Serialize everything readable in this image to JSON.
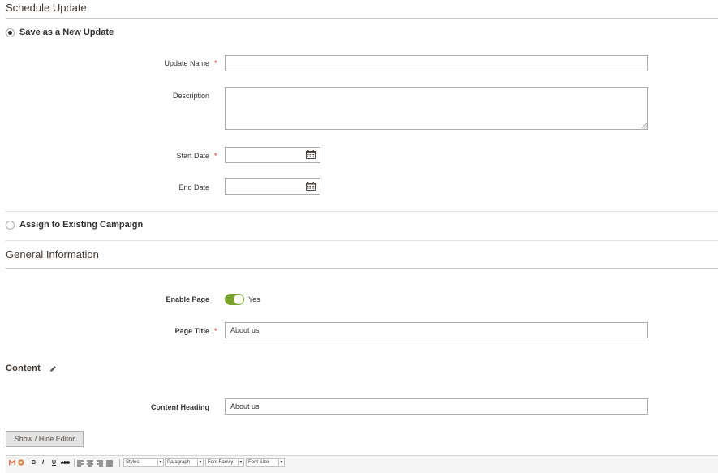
{
  "schedule": {
    "title": "Schedule Update",
    "option_new": "Save as a New Update",
    "option_existing": "Assign to Existing Campaign",
    "fields": {
      "update_name_label": "Update Name",
      "update_name_value": "",
      "description_label": "Description",
      "description_value": "",
      "start_date_label": "Start Date",
      "start_date_value": "",
      "end_date_label": "End Date",
      "end_date_value": ""
    },
    "required_mark": "*"
  },
  "general": {
    "title": "General Information",
    "enable_page_label": "Enable Page",
    "enable_page_value": "Yes",
    "enable_page_on": true,
    "page_title_label": "Page Title",
    "page_title_value": "About us"
  },
  "content": {
    "title": "Content",
    "heading_label": "Content Heading",
    "heading_value": "About us",
    "toggle_editor_button": "Show / Hide Editor"
  },
  "editor_toolbar": {
    "bold": "B",
    "italic": "I",
    "underline": "U",
    "strike": "ABC",
    "styles": "Styles",
    "format": "Paragraph",
    "font_family": "Font Family",
    "font_size": "Font Size"
  },
  "colors": {
    "accent_toggle": "#79a22e",
    "required": "#e22626",
    "divider": "#cccccc"
  }
}
